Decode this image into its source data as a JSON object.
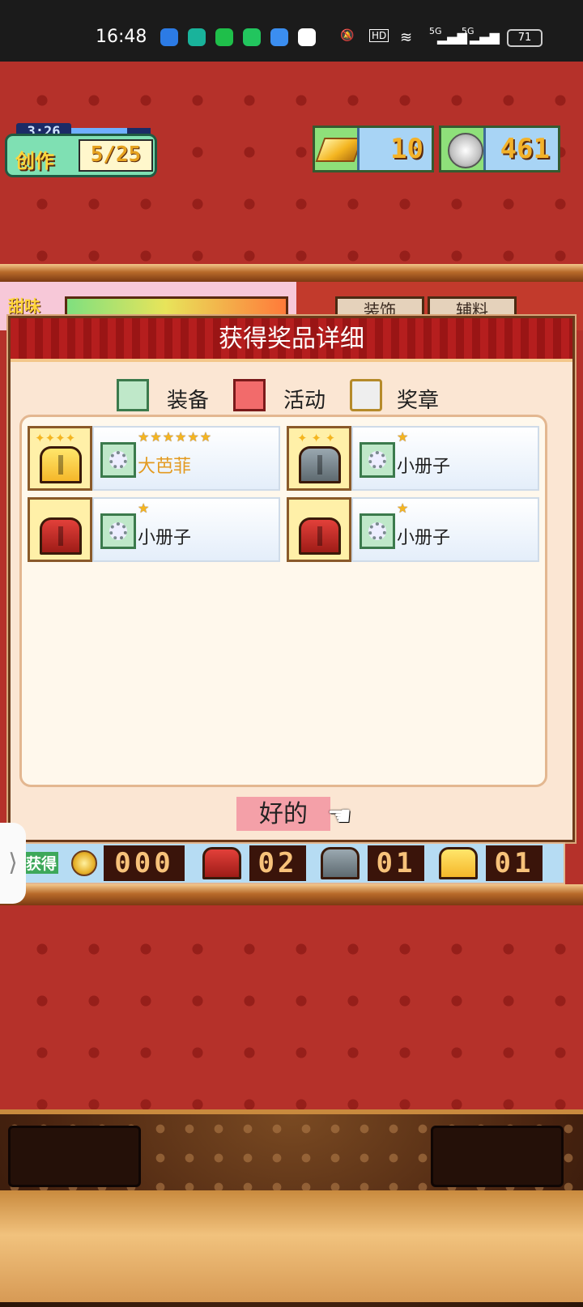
{
  "status_bar": {
    "time": "16:48",
    "network": "5G",
    "network2": "5G",
    "hd": "HD",
    "battery": "71"
  },
  "hud": {
    "timer": "3:26",
    "create_label": "创作",
    "create_count": "5/25",
    "gold_value": "10",
    "coin_value": "461",
    "sweet_label": "甜味",
    "tab1": "装饰",
    "tab2": "辅料"
  },
  "dialog": {
    "title": "获得奖品详细",
    "legend": [
      {
        "label": "装备",
        "icon": "gear-icon"
      },
      {
        "label": "活动",
        "icon": "key-icon"
      },
      {
        "label": "奖章",
        "icon": "medal-icon"
      }
    ],
    "items": [
      {
        "name": "大芭菲",
        "stars": "★★★★★★",
        "chest": "gold",
        "rare": true
      },
      {
        "name": "小册子",
        "stars": "★",
        "chest": "iron",
        "rare": false
      },
      {
        "name": "小册子",
        "stars": "★",
        "chest": "red",
        "rare": false
      },
      {
        "name": "小册子",
        "stars": "★",
        "chest": "red",
        "rare": false
      }
    ],
    "ok_button": "好的"
  },
  "got_bar": {
    "label": "获得",
    "coin_count": "000",
    "red_chest_count": "02",
    "iron_chest_count": "01",
    "gold_chest_count": "01"
  },
  "colors": {
    "wall": "#b5312a",
    "dialog_title": "#b51e1e",
    "rare_text": "#e39a1f",
    "ok_button": "#f4a0a8"
  }
}
